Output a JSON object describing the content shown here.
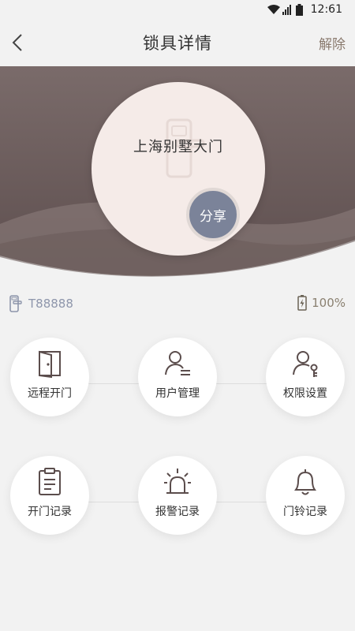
{
  "status_bar": {
    "time": "12:61"
  },
  "nav": {
    "title": "锁具详情",
    "action": "解除"
  },
  "lock": {
    "name": "上海别墅大门",
    "share_label": "分享"
  },
  "device": {
    "id": "T88888",
    "battery": "100%"
  },
  "functions": [
    {
      "label": "远程开门",
      "icon": "door-icon"
    },
    {
      "label": "用户管理",
      "icon": "user-list-icon"
    },
    {
      "label": "权限设置",
      "icon": "user-key-icon"
    },
    {
      "label": "开门记录",
      "icon": "clipboard-icon"
    },
    {
      "label": "报警记录",
      "icon": "alarm-light-icon"
    },
    {
      "label": "门铃记录",
      "icon": "bell-icon"
    }
  ],
  "colors": {
    "hero_dark": "#5e4f4f",
    "hero_light": "#8a7b78",
    "share": "#7b8399",
    "accent": "#8a7a6e"
  }
}
